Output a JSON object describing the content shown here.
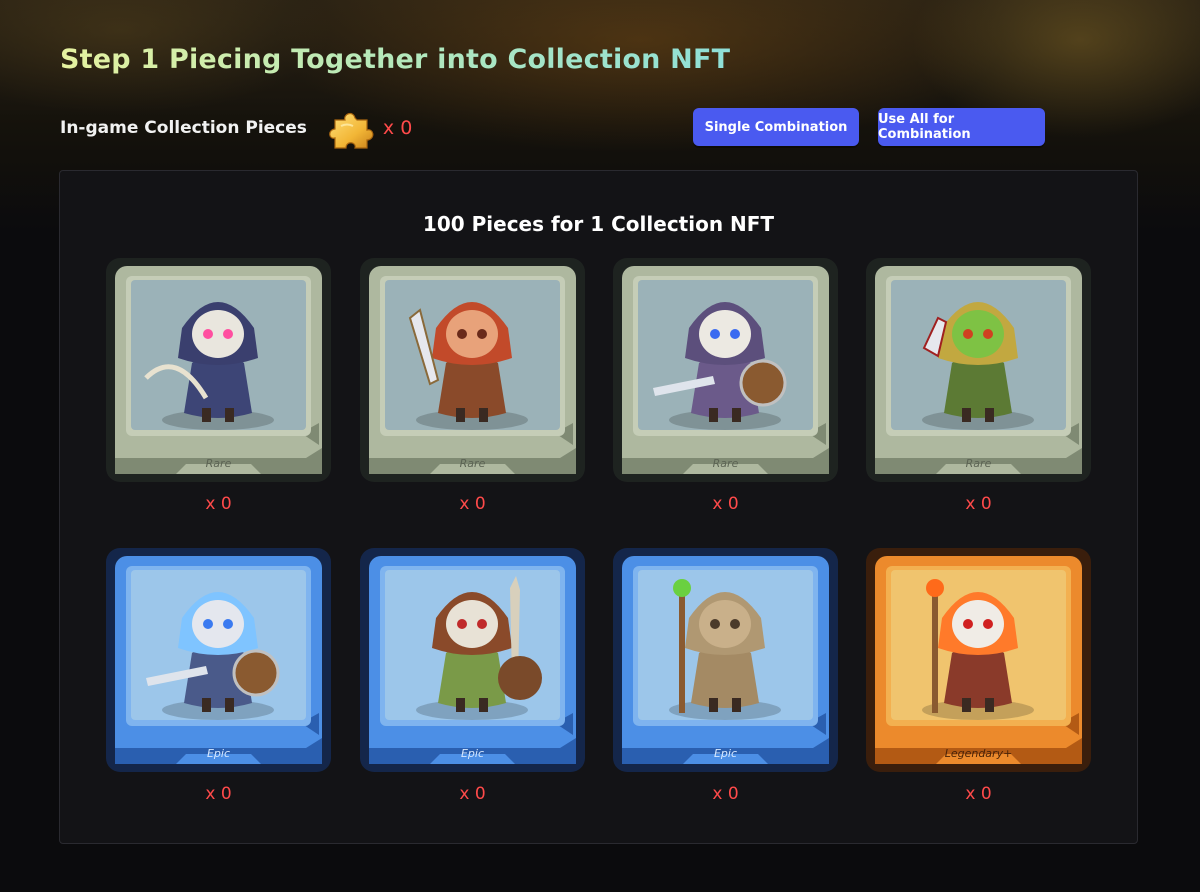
{
  "title": "Step 1 Piecing Together into Collection NFT",
  "pieces": {
    "label": "In-game Collection Pieces",
    "icon": "puzzle-piece-icon",
    "count": "x 0"
  },
  "buttons": {
    "single": "Single Combination",
    "all": "Use All for Combination"
  },
  "panel": {
    "title": "100 Pieces for 1 Collection NFT"
  },
  "colors": {
    "accent_button": "#4a5af0",
    "count_red": "#ff4a4a",
    "rare": "#aeb8a0",
    "epic": "#3f7fd8",
    "legendary": "#e2842a"
  },
  "cards": [
    {
      "character": "skeleton-archer",
      "rarity": "Rare",
      "count": "x 0"
    },
    {
      "character": "red-bearded-warrior",
      "rarity": "Rare",
      "count": "x 0"
    },
    {
      "character": "skeleton-swordsman",
      "rarity": "Rare",
      "count": "x 0"
    },
    {
      "character": "goblin-warrior",
      "rarity": "Rare",
      "count": "x 0"
    },
    {
      "character": "ice-skeleton-knight",
      "rarity": "Epic",
      "count": "x 0"
    },
    {
      "character": "antlered-goblin",
      "rarity": "Epic",
      "count": "x 0"
    },
    {
      "character": "hooded-druid",
      "rarity": "Epic",
      "count": "x 0"
    },
    {
      "character": "fire-skull-mage",
      "rarity": "Legendary",
      "count": "x 0"
    }
  ]
}
